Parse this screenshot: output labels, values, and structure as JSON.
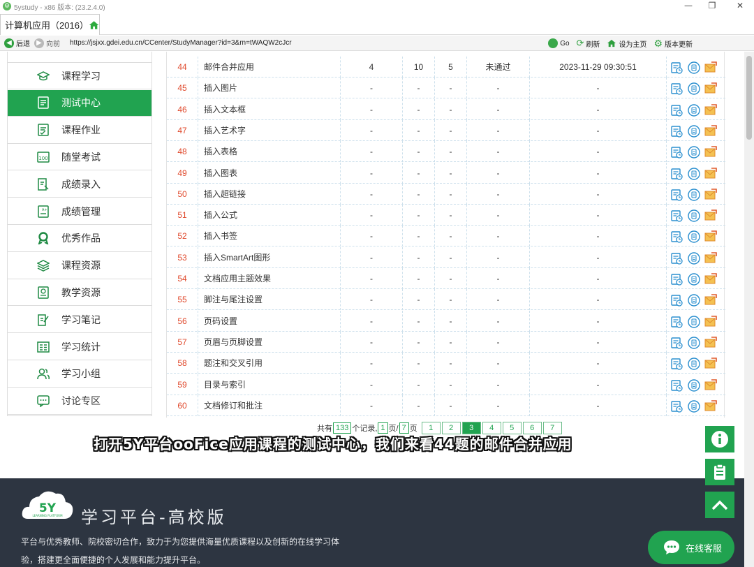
{
  "window": {
    "title": "5ystudy - x86 版本: (23.2.4.0)",
    "minimize_glyph": "—",
    "maximize_glyph": "❐",
    "close_glyph": "✕"
  },
  "tab": {
    "label": "计算机应用（2016）",
    "icon": "home-icon"
  },
  "addressbar": {
    "back_label": "后退",
    "forward_label": "向前",
    "url": "https://jsjxx.gdei.edu.cn/CCenter/StudyManager?id=3&rn=tWAQW2cJcr",
    "go_label": "Go",
    "refresh_label": "刷新",
    "sethome_label": "设为主页",
    "update_label": "版本更新"
  },
  "sidebar": {
    "items": [
      {
        "label": "课程学习",
        "icon": "graduation-cap-icon",
        "active": false
      },
      {
        "label": "测试中心",
        "icon": "test-list-icon",
        "active": true
      },
      {
        "label": "课程作业",
        "icon": "homework-icon",
        "active": false
      },
      {
        "label": "随堂考试",
        "icon": "exam-100-icon",
        "active": false
      },
      {
        "label": "成绩录入",
        "icon": "score-entry-icon",
        "active": false
      },
      {
        "label": "成绩管理",
        "icon": "score-manage-icon",
        "active": false
      },
      {
        "label": "优秀作品",
        "icon": "award-icon",
        "active": false
      },
      {
        "label": "课程资源",
        "icon": "layers-icon",
        "active": false
      },
      {
        "label": "教学资源",
        "icon": "teaching-resource-icon",
        "active": false
      },
      {
        "label": "学习笔记",
        "icon": "notes-icon",
        "active": false
      },
      {
        "label": "学习统计",
        "icon": "statistics-icon",
        "active": false
      },
      {
        "label": "学习小组",
        "icon": "group-icon",
        "active": false
      },
      {
        "label": "讨论专区",
        "icon": "discussion-icon",
        "active": false
      }
    ]
  },
  "table": {
    "rows": [
      {
        "no": "44",
        "name": "邮件合并应用",
        "c1": "4",
        "c2": "10",
        "c3": "5",
        "status": "未通过",
        "time": "2023-11-29 09:30:51"
      },
      {
        "no": "45",
        "name": "插入图片",
        "c1": "-",
        "c2": "-",
        "c3": "-",
        "status": "-",
        "time": "-"
      },
      {
        "no": "46",
        "name": "插入文本框",
        "c1": "-",
        "c2": "-",
        "c3": "-",
        "status": "-",
        "time": "-"
      },
      {
        "no": "47",
        "name": "插入艺术字",
        "c1": "-",
        "c2": "-",
        "c3": "-",
        "status": "-",
        "time": "-"
      },
      {
        "no": "48",
        "name": "插入表格",
        "c1": "-",
        "c2": "-",
        "c3": "-",
        "status": "-",
        "time": "-"
      },
      {
        "no": "49",
        "name": "插入图表",
        "c1": "-",
        "c2": "-",
        "c3": "-",
        "status": "-",
        "time": "-"
      },
      {
        "no": "50",
        "name": "插入超链接",
        "c1": "-",
        "c2": "-",
        "c3": "-",
        "status": "-",
        "time": "-"
      },
      {
        "no": "51",
        "name": "插入公式",
        "c1": "-",
        "c2": "-",
        "c3": "-",
        "status": "-",
        "time": "-"
      },
      {
        "no": "52",
        "name": "插入书签",
        "c1": "-",
        "c2": "-",
        "c3": "-",
        "status": "-",
        "time": "-"
      },
      {
        "no": "53",
        "name": "插入SmartArt图形",
        "c1": "-",
        "c2": "-",
        "c3": "-",
        "status": "-",
        "time": "-"
      },
      {
        "no": "54",
        "name": "文档应用主题效果",
        "c1": "-",
        "c2": "-",
        "c3": "-",
        "status": "-",
        "time": "-"
      },
      {
        "no": "55",
        "name": "脚注与尾注设置",
        "c1": "-",
        "c2": "-",
        "c3": "-",
        "status": "-",
        "time": "-"
      },
      {
        "no": "56",
        "name": "页码设置",
        "c1": "-",
        "c2": "-",
        "c3": "-",
        "status": "-",
        "time": "-"
      },
      {
        "no": "57",
        "name": "页眉与页脚设置",
        "c1": "-",
        "c2": "-",
        "c3": "-",
        "status": "-",
        "time": "-"
      },
      {
        "no": "58",
        "name": "题注和交叉引用",
        "c1": "-",
        "c2": "-",
        "c3": "-",
        "status": "-",
        "time": "-"
      },
      {
        "no": "59",
        "name": "目录与索引",
        "c1": "-",
        "c2": "-",
        "c3": "-",
        "status": "-",
        "time": "-"
      },
      {
        "no": "60",
        "name": "文档修订和批注",
        "c1": "-",
        "c2": "-",
        "c3": "-",
        "status": "-",
        "time": "-"
      }
    ],
    "row_actions": [
      "view-record-icon",
      "answer-icon",
      "submit-mail-icon"
    ]
  },
  "pagination": {
    "prefix": "共有",
    "total": "133",
    "records_label": "个记录,",
    "current": "1",
    "page_sep": "页/",
    "pages_total": "7",
    "page_label": "页",
    "pages": [
      "1",
      "2",
      "3",
      "4",
      "5",
      "6",
      "7"
    ],
    "current_page": "3"
  },
  "subtitle": "打开5Y平台ooFice应用课程的测试中心，我们来看44题的邮件合并应用",
  "footer": {
    "logo_text": "5Y",
    "logo_subtext": "LEARNING PLATFORM",
    "title": "学习平台-高校版",
    "desc": "平台与优秀教师、院校密切合作，致力于为您提供海量优质课程以及创新的在线学习体验，搭建更全面便捷的个人发展和能力提升平台。"
  },
  "float_buttons": [
    "info-icon",
    "clipboard-icon",
    "back-to-top-icon"
  ],
  "chat": {
    "label": "在线客服",
    "icon": "chat-bubble-icon"
  },
  "colors": {
    "brand_green": "#21a350",
    "row_number_red": "#e0492c",
    "footer_bg": "#2d3541"
  }
}
